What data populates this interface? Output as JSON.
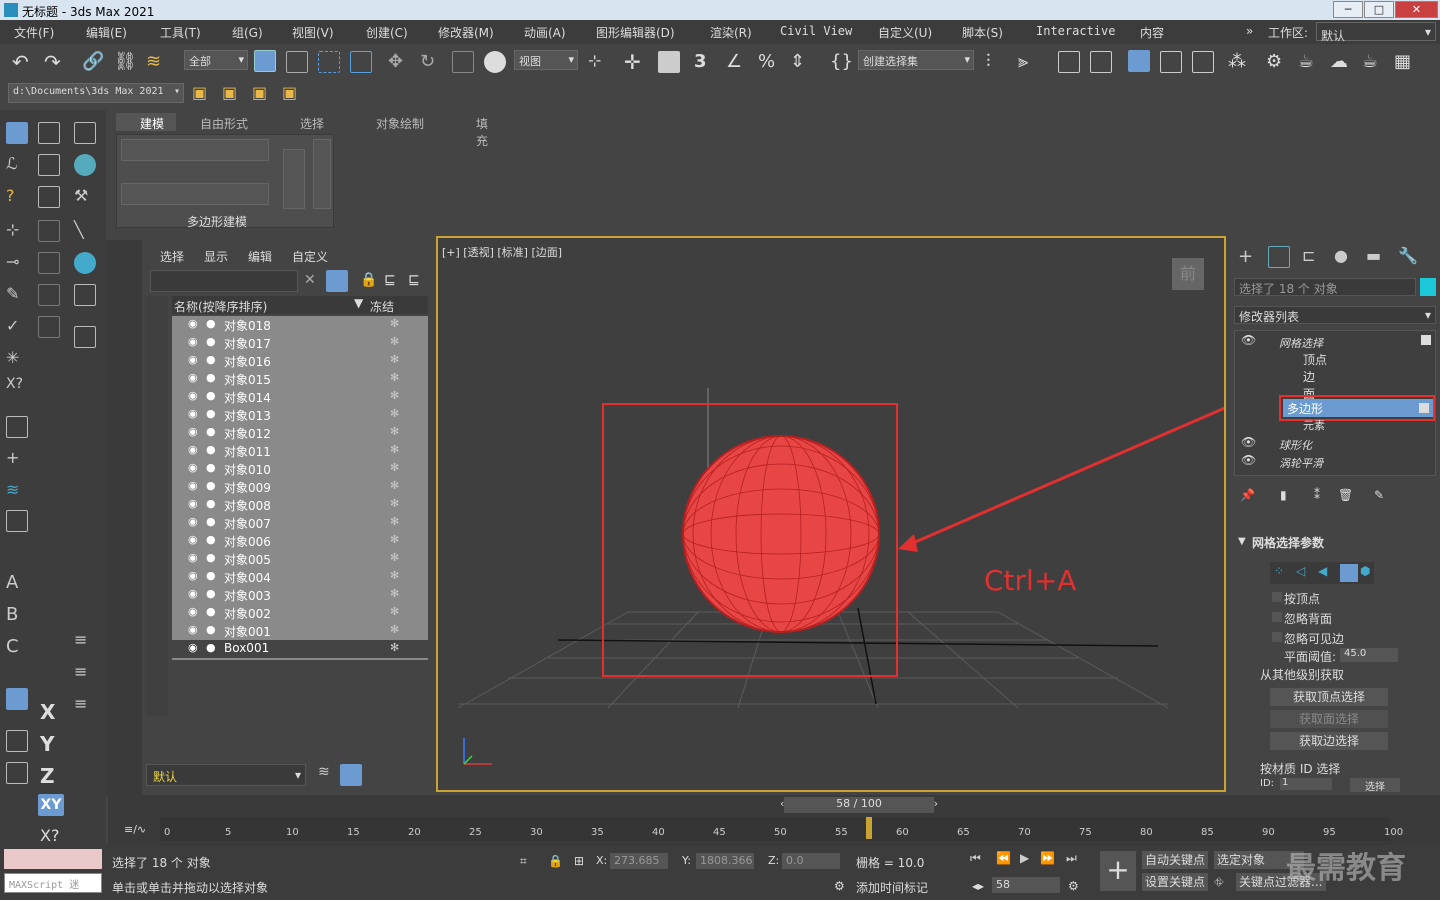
{
  "window": {
    "title": "无标题 - 3ds Max 2021",
    "min": "─",
    "max": "□",
    "close": "✕"
  },
  "menu": [
    "文件(F)",
    "编辑(E)",
    "工具(T)",
    "组(G)",
    "视图(V)",
    "创建(C)",
    "修改器(M)",
    "动画(A)",
    "图形编辑器(D)",
    "渲染(R)",
    "Civil View",
    "自定义(U)",
    "脚本(S)",
    "Interactive",
    "内容"
  ],
  "workspace": {
    "label": "工作区:",
    "value": "默认",
    "chev": "»"
  },
  "toolbar": {
    "filter": "全部",
    "refcoord": "视图",
    "selset": "创建选择集",
    "path": "d:\\Documents\\3ds Max 2021"
  },
  "ribbon": {
    "tabs": [
      "建模",
      "自由形式",
      "选择",
      "对象绘制",
      "填充"
    ],
    "group": "多边形建模"
  },
  "explorer": {
    "tabs": [
      "选择",
      "显示",
      "编辑",
      "自定义"
    ],
    "col_name": "名称(按降序排序)",
    "col_freeze": "冻结",
    "rows": [
      "对象018",
      "对象017",
      "对象016",
      "对象015",
      "对象014",
      "对象013",
      "对象012",
      "对象011",
      "对象010",
      "对象009",
      "对象008",
      "对象007",
      "对象006",
      "对象005",
      "对象004",
      "对象003",
      "对象002",
      "对象001",
      "Box001"
    ],
    "layer": "默认"
  },
  "viewport": {
    "label": "[+] [透视] [标准] [边面]",
    "front": "前",
    "annotation": "Ctrl+A",
    "accent": "#e23030"
  },
  "cmdpanel": {
    "selected": "选择了 18 个 对象",
    "modlist": "修改器列表",
    "stack": [
      {
        "name": "网格选择"
      },
      {
        "name": "顶点"
      },
      {
        "name": "边"
      },
      {
        "name": "面"
      },
      {
        "name": "多边形"
      },
      {
        "name": "元素"
      },
      {
        "name": "球形化"
      },
      {
        "name": "涡轮平滑"
      }
    ],
    "rollout": "网格选择参数",
    "checks": [
      "按顶点",
      "忽略背面",
      "忽略可见边"
    ],
    "threshold_label": "平面阈值:",
    "threshold": "45.0",
    "get_group": "从其他级别获取",
    "buttons": [
      "获取顶点选择",
      "获取面选择",
      "获取边选择"
    ],
    "matid": "按材质 ID 选择",
    "id_label": "ID:",
    "id_value": "1",
    "select": "选择"
  },
  "timeline": {
    "frame": "58 / 100",
    "ticks": [
      "0",
      "5",
      "10",
      "15",
      "20",
      "25",
      "30",
      "35",
      "40",
      "45",
      "50",
      "55",
      "60",
      "65",
      "70",
      "75",
      "80",
      "85",
      "90",
      "95",
      "100"
    ]
  },
  "status": {
    "selected": "选择了 18 个 对象",
    "hint": "单击或单击并拖动以选择对象",
    "maxscript": "MAXScript 迷",
    "x_label": "X:",
    "x": "273.685",
    "y_label": "Y:",
    "y": "1808.366",
    "z_label": "Z:",
    "z": "0.0",
    "grid": "栅格 = 10.0",
    "addtime": "添加时间标记",
    "autokey": "自动关键点",
    "selobj": "选定对象",
    "setkey": "设置关键点",
    "keyfilter": "关键点过滤器...",
    "frame": "58",
    "watermark": "最需教育"
  }
}
